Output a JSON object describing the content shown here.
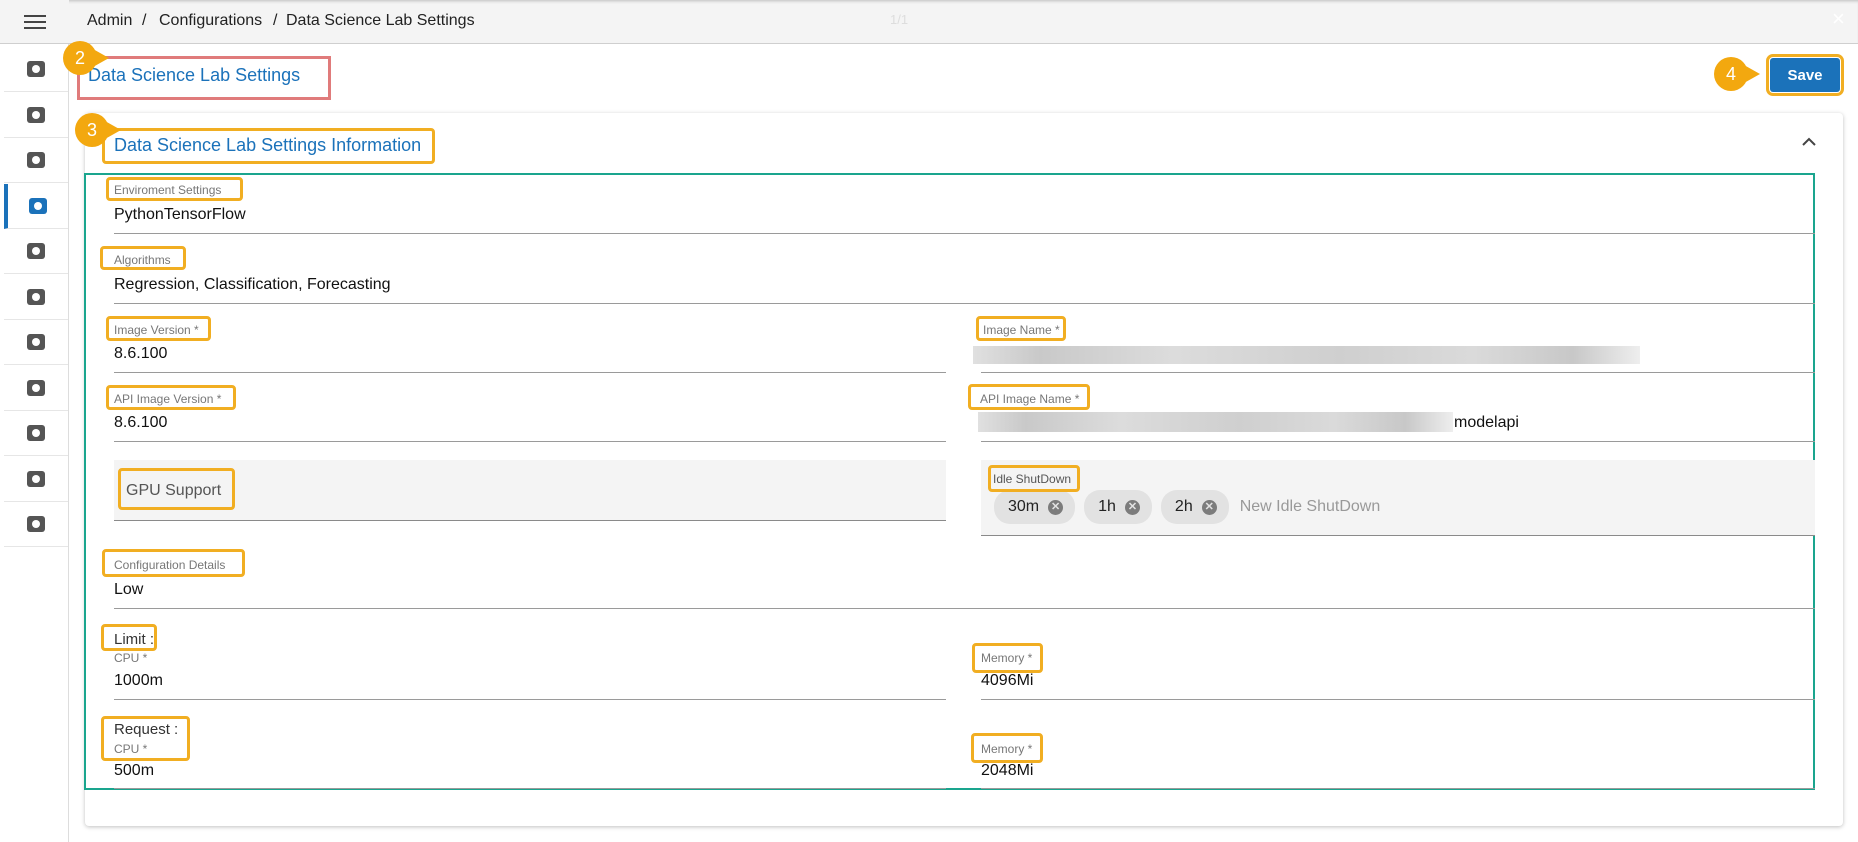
{
  "topbar": {
    "breadcrumb": [
      "Admin",
      "Configurations",
      "Data Science Lab Settings"
    ],
    "separator": "/",
    "page_counter": "1/1",
    "close": "×"
  },
  "sidebar": {
    "items": [
      "admin-settings",
      "billing",
      "security",
      "configurations",
      "document-settings",
      "network-cloud",
      "language",
      "certificate",
      "schedule-search",
      "server-alert",
      "user-history"
    ],
    "active": "configurations"
  },
  "page": {
    "title": "Data Science Lab Settings",
    "save_label": "Save"
  },
  "annotations": {
    "title": "2",
    "section": "3",
    "save": "4"
  },
  "section": {
    "title": "Data Science Lab Settings Information",
    "env_label": "Enviroment Settings",
    "env_value": "PythonTensorFlow",
    "alg_label": "Algorithms",
    "alg_value": "Regression, Classification, Forecasting",
    "image_version_label": "Image Version *",
    "image_version": "8.6.100",
    "image_name_label": "Image Name *",
    "api_image_version_label": "API Image Version *",
    "api_image_version": "8.6.100",
    "api_image_name_label": "API Image Name *",
    "api_image_name_suffix": "modelapi",
    "gpu_label": "GPU Support",
    "idle_label": "Idle ShutDown",
    "idle_chips": [
      "30m",
      "1h",
      "2h"
    ],
    "idle_placeholder": "New Idle ShutDown",
    "config_label": "Configuration Details",
    "config_value": "Low",
    "limit_label": "Limit :",
    "limit_cpu_label": "CPU *",
    "limit_cpu": "1000m",
    "limit_mem_label": "Memory *",
    "limit_mem": "4096Mi",
    "request_label": "Request :",
    "request_cpu_label": "CPU *",
    "request_cpu": "500m",
    "request_mem_label": "Memory *",
    "request_mem": "2048Mi"
  },
  "colors": {
    "accent": "#1b72ba",
    "highlight": "#f1ae22",
    "teal": "#1aa58e",
    "title_box": "#e07b7b"
  }
}
